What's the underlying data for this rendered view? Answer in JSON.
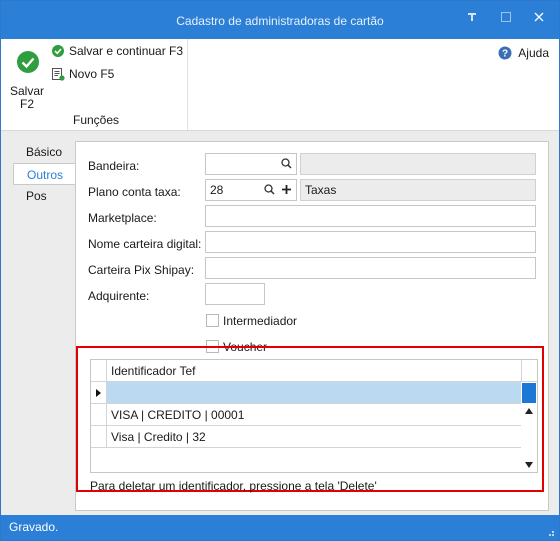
{
  "window": {
    "title": "Cadastro de administradoras de cartão"
  },
  "ribbon": {
    "save_label": "Salvar F2",
    "save_continue_label": "Salvar e continuar F3",
    "new_label": "Novo F5",
    "group_label": "Funções",
    "help_label": "Ajuda"
  },
  "tabs": [
    {
      "label": "Básico"
    },
    {
      "label": "Outros"
    },
    {
      "label": "Pos"
    }
  ],
  "form": {
    "bandeira_label": "Bandeira:",
    "bandeira_value": "",
    "bandeira_desc": "",
    "plano_label": "Plano conta taxa:",
    "plano_value": "28",
    "plano_desc": "Taxas",
    "marketplace_label": "Marketplace:",
    "marketplace_value": "",
    "carteira_label": "Nome carteira digital:",
    "carteira_value": "",
    "pix_label": "Carteira Pix Shipay:",
    "pix_value": "",
    "adquirente_label": "Adquirente:",
    "adquirente_value": "",
    "intermediador_label": "Intermediador",
    "voucher_label": "Voucher"
  },
  "grid": {
    "column": "Identificador Tef",
    "rows": [
      "",
      "VISA | CREDITO | 00001",
      "Visa | Credito | 32"
    ],
    "hint": "Para deletar um identificador, pressione a tela 'Delete'"
  },
  "status": {
    "text": "Gravado."
  },
  "colors": {
    "accent": "#2b7fd6",
    "highlight_border": "#e00000",
    "selected_row": "#bcd9f2"
  }
}
